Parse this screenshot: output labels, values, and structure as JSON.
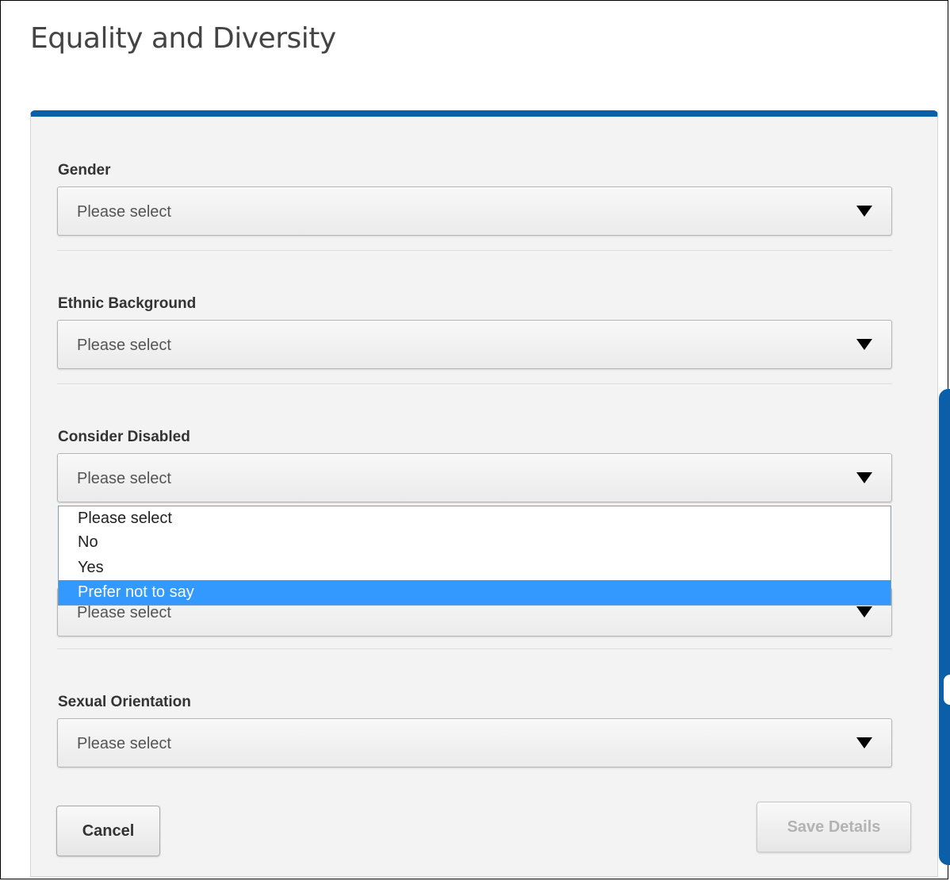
{
  "page": {
    "title": "Equality and Diversity"
  },
  "form": {
    "fields": [
      {
        "label": "Gender",
        "value": "Please select"
      },
      {
        "label": "Ethnic Background",
        "value": "Please select"
      },
      {
        "label": "Consider Disabled",
        "value": "Please select"
      },
      {
        "label": "",
        "value": "Please select"
      },
      {
        "label": "Sexual Orientation",
        "value": "Please select"
      }
    ],
    "open_dropdown": {
      "field": "Consider Disabled",
      "options": [
        "Please select",
        "No",
        "Yes",
        "Prefer not to say"
      ],
      "highlighted": "Prefer not to say"
    },
    "buttons": {
      "cancel_label": "Cancel",
      "save_label": "Save Details",
      "save_enabled": false
    }
  },
  "colors": {
    "accent": "#0b5fa8",
    "highlight": "#3399ff",
    "panel_background": "#f3f3f3"
  },
  "icons": {
    "select_caret": "caret-down-icon"
  }
}
